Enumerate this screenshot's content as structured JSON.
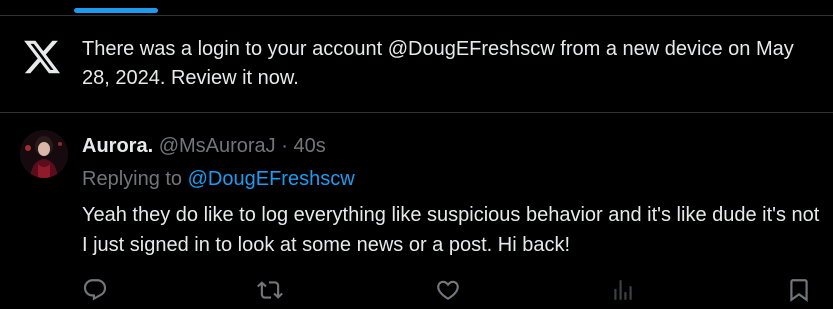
{
  "notification": {
    "icon": "x-logo-icon",
    "text": "There was a login to your account @DougEFreshscw from a new device on May 28, 2024. Review it now."
  },
  "reply": {
    "author": "Aurora.",
    "handle": "@MsAuroraJ",
    "separator": "·",
    "time": "40s",
    "replying_prefix": "Replying to",
    "replying_to": "@DougEFreshscw",
    "body": "Yeah they do like to log everything like suspicious behavior and it's like dude it's not I just signed in to look at some news or a post. Hi back!"
  },
  "actions": [
    "reply-icon",
    "repost-icon",
    "like-icon",
    "views-icon",
    "bookmark-icon"
  ],
  "colors": {
    "accent": "#1d9bf0",
    "muted": "#71767b",
    "text": "#e7e9ea",
    "divider": "#2f3336"
  }
}
